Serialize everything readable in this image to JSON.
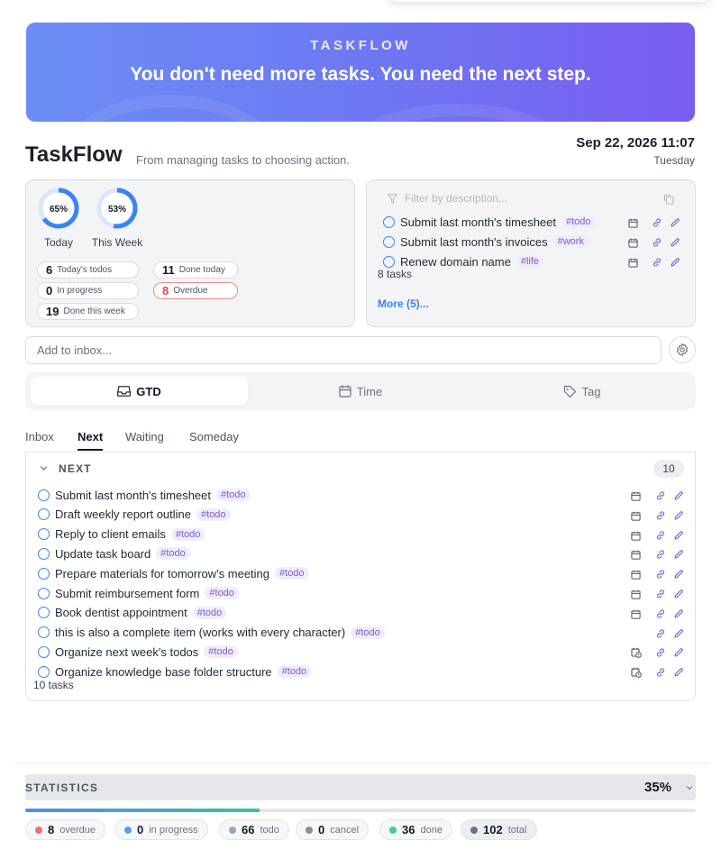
{
  "banner": {
    "brand": "TASKFLOW",
    "slogan": "You don't need more tasks. You need the next step."
  },
  "header": {
    "title": "TaskFlow",
    "subtitle": "From managing tasks to choosing action.",
    "datetime": "Sep 22, 2026 11:07",
    "weekday": "Tuesday"
  },
  "progress": {
    "today": {
      "value": 0.65,
      "label": "65%",
      "caption": "Today"
    },
    "week": {
      "value": 0.53,
      "label": "53%",
      "caption": "This Week"
    },
    "pills": [
      {
        "num": "6",
        "text": "Today's todos"
      },
      {
        "num": "11",
        "text": "Done today"
      },
      {
        "num": "0",
        "text": "In progress"
      },
      {
        "num": "8",
        "text": "Overdue"
      },
      {
        "num": "19",
        "text": "Done this week"
      }
    ]
  },
  "quick": {
    "filter_placeholder": "Filter by description...",
    "items": [
      {
        "text": "Submit last month's timesheet",
        "tag": "#todo"
      },
      {
        "text": "Submit last month's invoices",
        "tag": "#work"
      },
      {
        "text": "Renew domain name",
        "tag": "#life"
      }
    ],
    "count": "8 tasks",
    "more": "More (5)..."
  },
  "inbox": {
    "placeholder": "Add to inbox..."
  },
  "segments": [
    {
      "label": "GTD",
      "icon": "inbox-icon"
    },
    {
      "label": "Time",
      "icon": "calendar-icon"
    },
    {
      "label": "Tag",
      "icon": "tag-icon"
    }
  ],
  "tabs": [
    "Inbox",
    "Next",
    "Waiting",
    "Someday"
  ],
  "next": {
    "title": "NEXT",
    "badge": "10",
    "items": [
      {
        "text": "Submit last month's timesheet",
        "tag": "#todo"
      },
      {
        "text": "Draft weekly report outline",
        "tag": "#todo"
      },
      {
        "text": "Reply to client emails",
        "tag": "#todo"
      },
      {
        "text": "Update task board",
        "tag": "#todo"
      },
      {
        "text": "Prepare materials for tomorrow's meeting",
        "tag": "#todo"
      },
      {
        "text": "Submit reimbursement form",
        "tag": "#todo"
      },
      {
        "text": "Book dentist appointment",
        "tag": "#todo"
      },
      {
        "text": "this is also a complete item (works with every character)",
        "tag": "#todo"
      },
      {
        "text": "Organize next week's todos",
        "tag": "#todo"
      },
      {
        "text": "Organize knowledge base folder structure",
        "tag": "#todo"
      }
    ],
    "count": "10 tasks"
  },
  "stats": {
    "label": "STATISTICS",
    "percent": "35%",
    "progress": 0.35,
    "pills": [
      {
        "num": "8",
        "text": "overdue",
        "color": "#f07070"
      },
      {
        "num": "0",
        "text": "in progress",
        "color": "#5b9cf0"
      },
      {
        "num": "66",
        "text": "todo",
        "color": "#9aa6b8"
      },
      {
        "num": "0",
        "text": "cancel",
        "color": "#8a8f98"
      },
      {
        "num": "36",
        "text": "done",
        "color": "#3fcf8e"
      },
      {
        "num": "102",
        "text": "total",
        "color": "#6b7280"
      }
    ]
  },
  "colors": {
    "accent": "#3b82f6",
    "tag_bg": "#f1ecfd",
    "tag_text": "#7c5ccf",
    "overdue": "#e5484d"
  }
}
